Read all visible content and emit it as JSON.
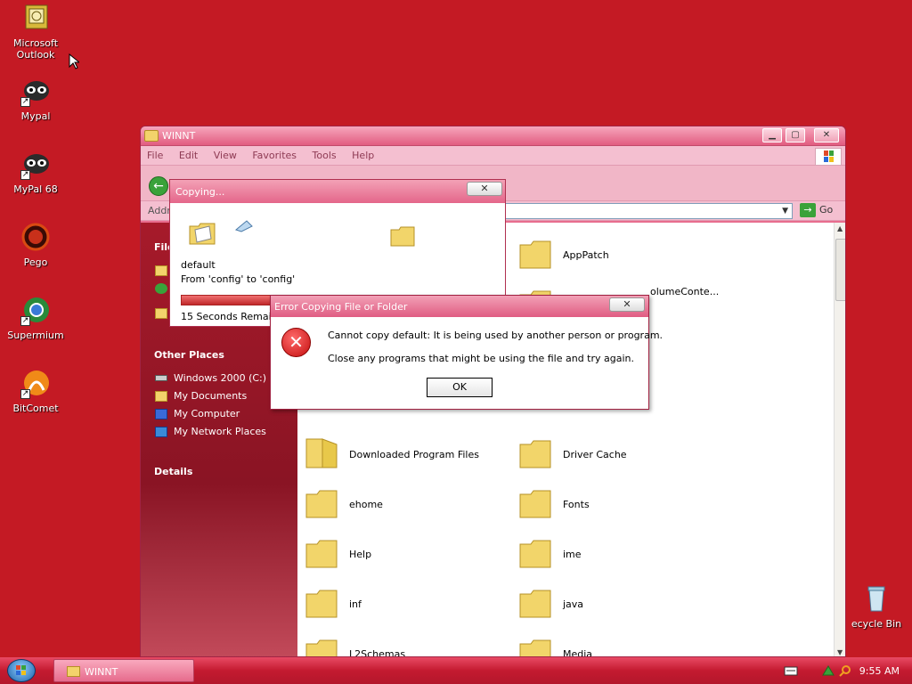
{
  "desktop": {
    "icons": [
      {
        "label": "Microsoft Outlook",
        "icon": "outlook-icon"
      },
      {
        "label": "Mypal",
        "icon": "mypal-icon"
      },
      {
        "label": "MyPal 68",
        "icon": "mypal-icon"
      },
      {
        "label": "Pego",
        "icon": "pego-icon"
      },
      {
        "label": "Supermium",
        "icon": "supermium-icon"
      },
      {
        "label": "BitComet",
        "icon": "bitcomet-icon"
      },
      {
        "label": "ecycle Bin",
        "icon": "recycle-bin-icon"
      }
    ]
  },
  "explorer": {
    "title": "WINNT",
    "menu": [
      "File",
      "Edit",
      "View",
      "Favorites",
      "Tools",
      "Help"
    ],
    "address_label": "Addr",
    "go_label": "Go",
    "taskpane": {
      "file_heading": "File",
      "other_places_heading": "Other Places",
      "other_places": [
        "Windows 2000 (C:)",
        "My Documents",
        "My Computer",
        "My Network Places"
      ],
      "details_heading": "Details"
    },
    "folders": [
      {
        "name": "AppPatch"
      },
      {
        "name": "olumeConte..."
      },
      {
        "name": "Downloaded Program Files"
      },
      {
        "name": "Driver Cache"
      },
      {
        "name": "ehome"
      },
      {
        "name": "Fonts"
      },
      {
        "name": "Help"
      },
      {
        "name": "ime"
      },
      {
        "name": "inf"
      },
      {
        "name": "java"
      },
      {
        "name": "L2Schemas"
      },
      {
        "name": "Media"
      }
    ]
  },
  "copy_dialog": {
    "title": "Copying...",
    "close_label": "✕",
    "item": "default",
    "from_to": "From 'config' to 'config'",
    "remaining": "15 Seconds Remainin",
    "progress": 0.35
  },
  "error_dialog": {
    "title": "Error Copying File or Folder",
    "message1": "Cannot copy default: It is being used by another person or program.",
    "message2": "Close any programs that might be using the file and try again.",
    "ok_label": "OK",
    "close_label": "✕"
  },
  "taskbar": {
    "task_label": "WINNT",
    "clock": "9:55 AM"
  },
  "colors": {
    "desktop": "#c41a24",
    "window_frame": "#e86d8e",
    "taskpane": "#a61a2a"
  }
}
